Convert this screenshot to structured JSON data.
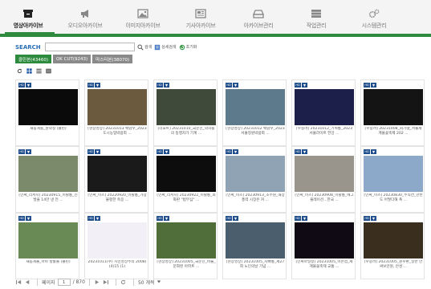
{
  "nav": {
    "items": [
      {
        "label": "영상아카이브",
        "icon": "archive-box-icon",
        "active": true
      },
      {
        "label": "오디오아카이브",
        "icon": "megaphone-icon",
        "active": false
      },
      {
        "label": "이미지아카이브",
        "icon": "image-icon",
        "active": false
      },
      {
        "label": "기사아카이브",
        "icon": "newspaper-icon",
        "active": false
      },
      {
        "label": "아카이브관리",
        "icon": "drive-icon",
        "active": false
      },
      {
        "label": "작업관리",
        "icon": "server-icon",
        "active": false
      },
      {
        "label": "시스템관리",
        "icon": "gears-icon",
        "active": false
      }
    ]
  },
  "search": {
    "label": "SEARCH",
    "value": "",
    "search_button": "검색",
    "detail_button": "상세검색",
    "reset_button": "초기화"
  },
  "tabs": [
    {
      "label": "클린본(43460)",
      "active": true
    },
    {
      "label": "OK CUT(9243)",
      "active": false
    },
    {
      "label": "마스터본(38070)",
      "active": false
    }
  ],
  "colors": {
    "accent": "#2e8b3e",
    "badge": "#1f4e8c"
  },
  "cards": [
    {
      "caption": "새롭게를_원약정 (클린)",
      "bg": "#0a0a0a"
    },
    {
      "caption": "[현장영상] 20231013 백남우_2023 도시농업박람회 ...",
      "bg": "#6b5a3e"
    },
    {
      "caption": "[리포트] 20231010_국문진_약자를의 동행자가 기계 ...",
      "bg": "#3f4a3a"
    },
    {
      "caption": "[현장영상] 20231012 백남우_2023 서울정원박람회 ...",
      "bg": "#5c7a8c"
    },
    {
      "caption": "[우중려] 20231012_기획통_2023 서울라이트 한강 ...",
      "bg": "#1b1f4a"
    },
    {
      "caption": "[우중려] 20231008_회가넷_서울세계불꽃축제 202 ...",
      "bg": "#141414"
    },
    {
      "caption": "[인싸_리서치] 20230915_이탈통_신발을 14만 낸 전 ...",
      "bg": "#7a8a6a"
    },
    {
      "caption": "[인싸_이즈] 20220920_이탈통_가장 불평한 축응 ...",
      "bg": "#1a1a1a"
    },
    {
      "caption": "[인싸_리서치] 20230922_이탈통_외화판 \"법부심\" ...",
      "bg": "#0d0d0d"
    },
    {
      "caption": "[인싸_이즈] 20230913_조주원_해상풍력 시장은 커 ...",
      "bg": "#8fa3b5"
    },
    {
      "caption": "[인싸_이즈] 20230908_이탈통_에그플레이션...한국 ...",
      "bg": "#9a958c"
    },
    {
      "caption": "[인싸_이즈] 20230830_주칙연_한반도 어떻다해 폭 ...",
      "bg": "#8da9c9"
    },
    {
      "caption": "새롭게울_아파 방활볼 (클린)",
      "bg": "#6a8a55"
    },
    {
      "caption": "20231011(수) 시민영상주의 2008( (4)15 (1)",
      "bg": "#f2f0f6"
    },
    {
      "caption": "[현장영상] 20231005_국문진_비둘_문화된 아파트 ...",
      "bg": "#4f6e3a"
    },
    {
      "caption": "[현장영상] 20231005_지빠통_제27회 노인의날 기념 ...",
      "bg": "#4a5e6e"
    },
    {
      "caption": "[인싸마일정] 20231005_이은섭_세계불꽃축제 교통 ...",
      "bg": "#100a14"
    },
    {
      "caption": "[우중려] 20231005_원우환_일반 안싸보안원, 안성 ...",
      "bg": "#3a2e1e"
    }
  ],
  "pager": {
    "page_label": "페이지",
    "current_page": "1",
    "total_pages": "/ 870",
    "per_page": "50 개씩"
  }
}
